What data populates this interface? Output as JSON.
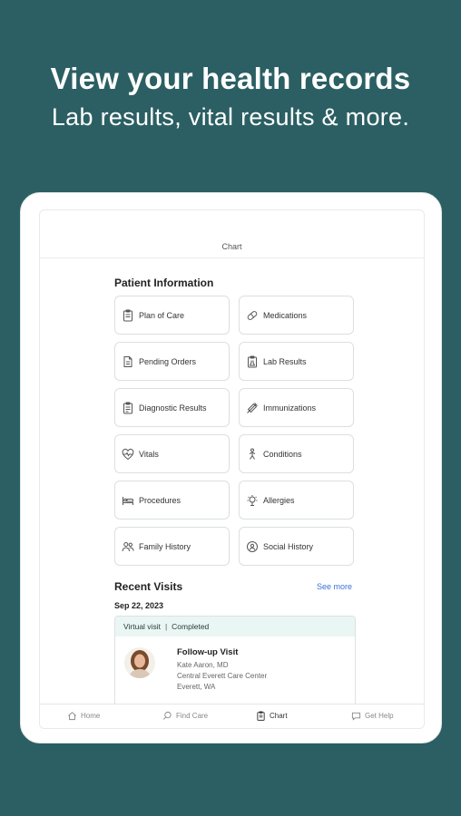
{
  "promo": {
    "headline": "View your health records",
    "subline": "Lab results, vital results & more."
  },
  "header": {
    "title": "Chart"
  },
  "patient_info": {
    "title": "Patient Information",
    "tiles": [
      {
        "label": "Plan of Care",
        "icon": "clipboard-icon"
      },
      {
        "label": "Medications",
        "icon": "pill-icon"
      },
      {
        "label": "Pending Orders",
        "icon": "document-icon"
      },
      {
        "label": "Lab Results",
        "icon": "lab-clipboard-icon"
      },
      {
        "label": "Diagnostic Results",
        "icon": "diagnostic-clipboard-icon"
      },
      {
        "label": "Immunizations",
        "icon": "syringe-icon"
      },
      {
        "label": "Vitals",
        "icon": "heart-pulse-icon"
      },
      {
        "label": "Conditions",
        "icon": "body-icon"
      },
      {
        "label": "Procedures",
        "icon": "bed-icon"
      },
      {
        "label": "Allergies",
        "icon": "allergy-icon"
      },
      {
        "label": "Family History",
        "icon": "people-icon"
      },
      {
        "label": "Social History",
        "icon": "social-icon"
      }
    ]
  },
  "recent_visits": {
    "title": "Recent Visits",
    "see_more": "See more",
    "date": "Sep 22, 2023",
    "visit": {
      "mode": "Virtual visit",
      "separator": "|",
      "status": "Completed",
      "type": "Follow-up Visit",
      "provider": "Kate Aaron, MD",
      "location": "Central Everett Care Center",
      "city": "Everett, WA"
    }
  },
  "nav": {
    "items": [
      {
        "label": "Home",
        "icon": "home-icon"
      },
      {
        "label": "Find Care",
        "icon": "search-icon"
      },
      {
        "label": "Chart",
        "icon": "chart-clipboard-icon"
      },
      {
        "label": "Get Help",
        "icon": "chat-icon"
      }
    ]
  },
  "colors": {
    "background": "#2b5f63",
    "status_bg": "#eaf6f3",
    "link": "#3a6fd8"
  }
}
